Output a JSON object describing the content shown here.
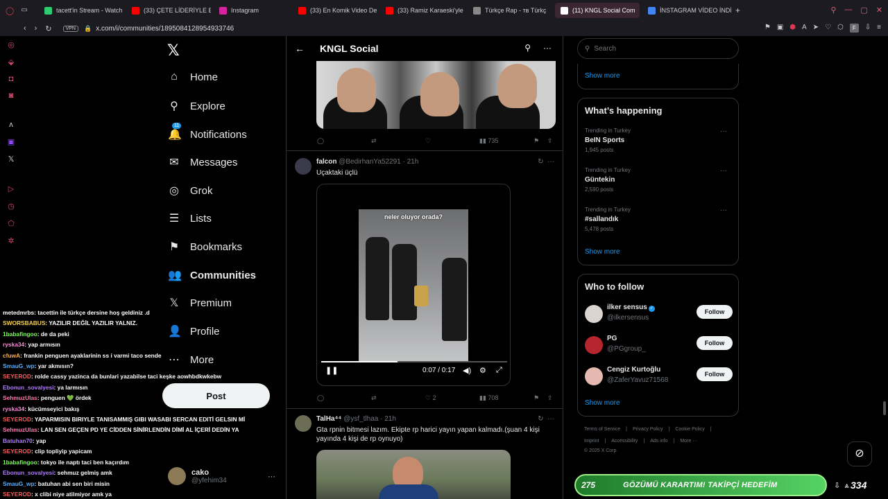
{
  "browser": {
    "tabs": [
      {
        "label": "tacett'in Stream - Watch L",
        "color": "#2ecc71"
      },
      {
        "label": "(33) ÇETE LİDERİYLE BA",
        "color": "#ff0000"
      },
      {
        "label": "Instagram",
        "color": "#d6249f"
      },
      {
        "label": "(33) En Komik Video Der",
        "color": "#ff0000"
      },
      {
        "label": "(33) Ramiz Karaeski'yle C",
        "color": "#ff0000"
      },
      {
        "label": "Türkçe Rap - тв Türkç",
        "color": "#888888"
      },
      {
        "label": "(11) KNGL Social Com",
        "color": "#ffffff"
      },
      {
        "label": "İNSTAGRAM VİDEO İNDİR",
        "color": "#4285f4"
      }
    ],
    "url": "x.com/i/communities/1895084128954933746",
    "vpn": "VPN",
    "profile_initial": "F"
  },
  "nav": {
    "items": [
      {
        "label": "Home",
        "icon": "⌂"
      },
      {
        "label": "Explore",
        "icon": "⚲"
      },
      {
        "label": "Notifications",
        "icon": "🔔",
        "badge": "11"
      },
      {
        "label": "Messages",
        "icon": "✉"
      },
      {
        "label": "Grok",
        "icon": "◎"
      },
      {
        "label": "Lists",
        "icon": "☰"
      },
      {
        "label": "Bookmarks",
        "icon": "⚑"
      },
      {
        "label": "Communities",
        "icon": "👥"
      },
      {
        "label": "Premium",
        "icon": "𝕏"
      },
      {
        "label": "Profile",
        "icon": "👤"
      },
      {
        "label": "More",
        "icon": "⋯"
      }
    ],
    "post_label": "Post",
    "account": {
      "name": "cako",
      "handle": "@yfehim34"
    }
  },
  "chat": [
    {
      "user": "metedmrbs",
      "color": "#ffffff",
      "text": ": tacettin ile türkçe dersine hoş geldiniz .d"
    },
    {
      "user": "SWORSBABUS",
      "color": "#f7d154",
      "text": ": YAZILIR DEĞİL YAZILIR YALNIZ."
    },
    {
      "user": "1babafingoo",
      "color": "#7dff5a",
      "text": ": de da peki"
    },
    {
      "user": "ryska34",
      "color": "#ff8ad8",
      "text": ": yap armısın"
    },
    {
      "user": "cfuwA",
      "color": "#ffb347",
      "text": ": frankin penguen ayaklarinin ss i varmi taco sende"
    },
    {
      "user": "SmauG_wp",
      "color": "#5ab0ff",
      "text": ": yar akmısın?"
    },
    {
      "user": "SEYEROD",
      "color": "#ff5a5a",
      "text": ": rolde cassy yazinca da bunlari yazabilse taci keşke aowhbdkwkebw"
    },
    {
      "user": "Ebonun_sovalyesi",
      "color": "#b07bff",
      "text": ": ya larmısın"
    },
    {
      "user": "SehmuzUlas",
      "color": "#ff7ab0",
      "text": ": penguen 💚 ördek"
    },
    {
      "user": "ryska34",
      "color": "#ff8ad8",
      "text": ": kücümseyici bakış"
    },
    {
      "user": "SEYEROD",
      "color": "#ff5a5a",
      "text": ": YAPARMISIN BIRIYLE TANISAMMIŞ GIBI WASABI SERCAN EDITİ GELSIN Mİ"
    },
    {
      "user": "SehmuzUlas",
      "color": "#ff7ab0",
      "text": ": LAN SEN GEÇEN PD YE CİDDEN SİNİRLENDİN DİMİ AL İÇERİ DEDİN YA"
    },
    {
      "user": "Batuhan70",
      "color": "#b07bff",
      "text": ": yap"
    },
    {
      "user": "SEYEROD",
      "color": "#ff5a5a",
      "text": ": clip topliyip yapicam"
    },
    {
      "user": "1babafingoo",
      "color": "#7dff5a",
      "text": ": tokyo ile naptı taci ben kaçırdım"
    },
    {
      "user": "Ebonun_sovalyesi",
      "color": "#b07bff",
      "text": ": sehmuz gelmiş amk"
    },
    {
      "user": "SmauG_wp",
      "color": "#5ab0ff",
      "text": ": batuhan abi sen biri misin"
    },
    {
      "user": "SEYEROD",
      "color": "#ff5a5a",
      "text": ": x clibi niye atilmiyor amk ya"
    }
  ],
  "center": {
    "title": "KNGL Social",
    "tweet1_actions": {
      "views": "735"
    },
    "tweet2": {
      "name": "falcon",
      "handle": "@BedirhanYa52291",
      "time": "· 21h",
      "text": "Uçaktaki üçlü",
      "caption": "neler oluyor orada?",
      "video_time": "0:07 / 0:17",
      "progress": 0.41,
      "likes": "2",
      "views": "708"
    },
    "tweet3": {
      "name": "TalHa⁴⁴",
      "handle": "@ysf_tlhaa",
      "time": "· 21h",
      "text": "Gta rpnin bitmesi lazım. Ekipte rp harici yayın yapan kalmadı.(şuan 4 kişi yayında 4 kişi de rp oynuyo)"
    }
  },
  "right": {
    "search_placeholder": "Search",
    "show_more": "Show more",
    "happening_title": "What’s happening",
    "trends": [
      {
        "meta": "Trending in Turkey",
        "name": "BeIN Sports",
        "posts": "1,945 posts"
      },
      {
        "meta": "Trending in Turkey",
        "name": "Güntekin",
        "posts": "2,590 posts"
      },
      {
        "meta": "Trending in Turkey",
        "name": "#sallandık",
        "posts": "5,478 posts"
      }
    ],
    "follow_title": "Who to follow",
    "follow": [
      {
        "name": "ilker sensus",
        "handle": "@ilkersensus",
        "verified": true,
        "color": "#d9d4cf"
      },
      {
        "name": "PG",
        "handle": "@PGgroup_",
        "verified": false,
        "color": "#b5252e"
      },
      {
        "name": "Cengiz Kurtoğlu",
        "handle": "@ZaferYavuz71568",
        "verified": false,
        "color": "#e5b9b0"
      }
    ],
    "follow_label": "Follow",
    "footer1": [
      "Terms of Service",
      "|",
      "Privacy Policy",
      "|",
      "Cookie Policy",
      "|"
    ],
    "footer2": [
      "Imprint",
      "|",
      "Accessibility",
      "|",
      "Ads info",
      "|",
      "More ···"
    ],
    "footer3": "© 2025 X Corp."
  },
  "goal": {
    "current": "275",
    "text": "GÖZÜMÜ KARARTIM! TAKİPÇİ HEDEFİM",
    "target": "334"
  }
}
